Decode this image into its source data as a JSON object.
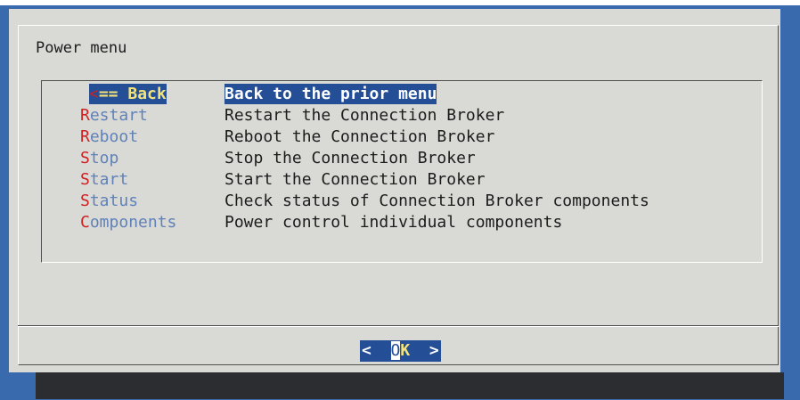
{
  "dialog": {
    "title": "Power menu"
  },
  "menu": {
    "items": [
      {
        "hot": "<",
        "rest": "== Back",
        "description": "Back to the prior menu",
        "selected": true
      },
      {
        "hot": "R",
        "rest": "estart",
        "description": "Restart the Connection Broker"
      },
      {
        "hot": "R",
        "rest": "eboot",
        "description": "Reboot the Connection Broker"
      },
      {
        "hot": "S",
        "rest": "top",
        "description": "Stop the Connection Broker"
      },
      {
        "hot": "S",
        "rest": "tart",
        "description": "Start the Connection Broker"
      },
      {
        "hot": "S",
        "rest": "tatus",
        "description": "Check status of Connection Broker components"
      },
      {
        "hot": "C",
        "rest": "omponents",
        "description": "Power control individual components"
      }
    ]
  },
  "buttons": {
    "ok": {
      "left": "<",
      "hot_o": "O",
      "hot_k": "K",
      "right": ">"
    }
  },
  "colors": {
    "background": "#3a6aae",
    "dialog": "#d9d9d6",
    "selection": "#244f96",
    "hotkey": "#cc2222",
    "tag_text": "#5f82b8",
    "highlight_text": "#f4e27a"
  }
}
